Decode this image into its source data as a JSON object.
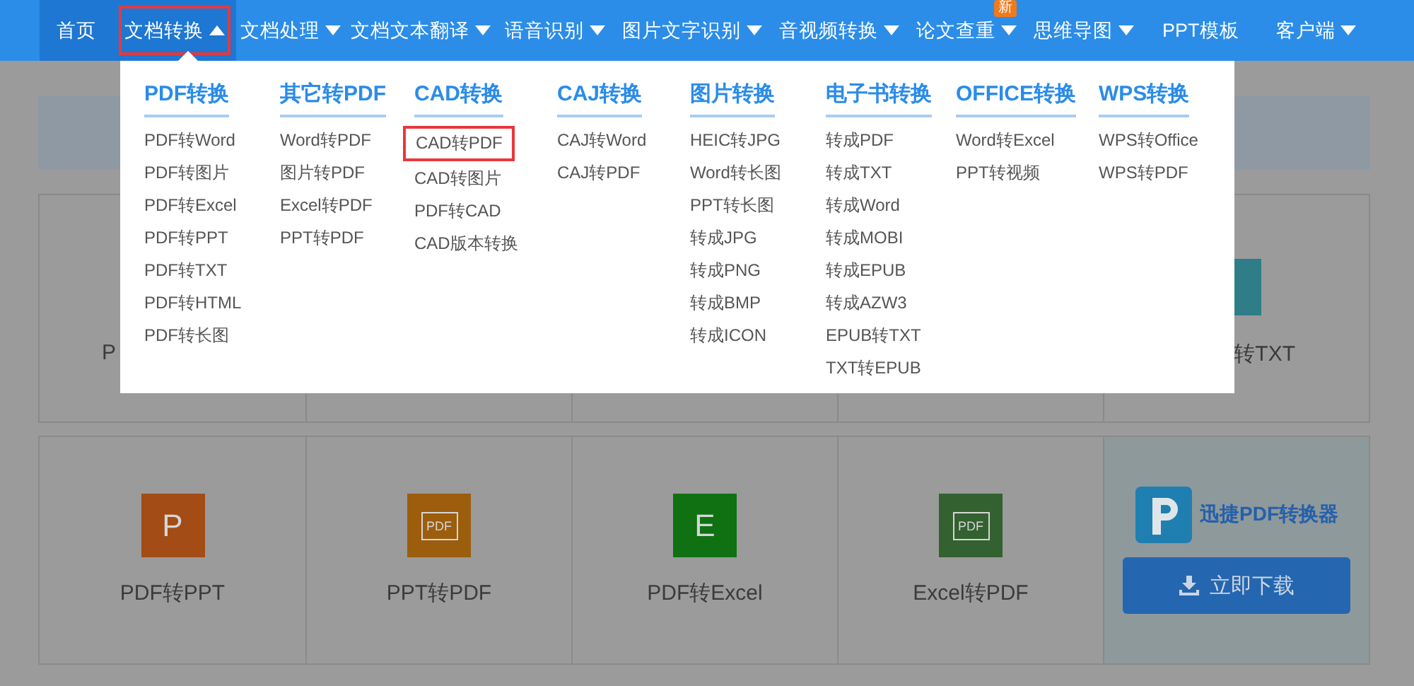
{
  "nav": [
    {
      "label": "首页",
      "kind": "link",
      "current": true
    },
    {
      "label": "文档转换",
      "kind": "menu",
      "expanded": true,
      "highlighted": true
    },
    {
      "label": "文档处理",
      "kind": "menu",
      "expanded": false
    },
    {
      "label": "文档文本翻译",
      "kind": "menu",
      "expanded": false
    },
    {
      "label": "语音识别",
      "kind": "menu",
      "expanded": false
    },
    {
      "label": "图片文字识别",
      "kind": "menu",
      "expanded": false
    },
    {
      "label": "音视频转换",
      "kind": "menu",
      "expanded": false
    },
    {
      "label": "论文查重",
      "kind": "menu",
      "expanded": false,
      "badge": "新"
    },
    {
      "label": "思维导图",
      "kind": "menu",
      "expanded": false
    },
    {
      "label": "PPT模板",
      "kind": "link",
      "current": false
    },
    {
      "label": "客户端",
      "kind": "menu",
      "expanded": false
    }
  ],
  "dropdown": {
    "columns": [
      {
        "heading": "PDF转换",
        "items": [
          {
            "label": "PDF转Word"
          },
          {
            "label": "PDF转图片"
          },
          {
            "label": "PDF转Excel"
          },
          {
            "label": "PDF转PPT"
          },
          {
            "label": "PDF转TXT"
          },
          {
            "label": "PDF转HTML"
          },
          {
            "label": "PDF转长图"
          }
        ]
      },
      {
        "heading": "其它转PDF",
        "items": [
          {
            "label": "Word转PDF"
          },
          {
            "label": "图片转PDF"
          },
          {
            "label": "Excel转PDF"
          },
          {
            "label": "PPT转PDF"
          }
        ]
      },
      {
        "heading": "CAD转换",
        "items": [
          {
            "label": "CAD转PDF",
            "highlighted": true
          },
          {
            "label": "CAD转图片"
          },
          {
            "label": "PDF转CAD"
          },
          {
            "label": "CAD版本转换"
          }
        ]
      },
      {
        "heading": "CAJ转换",
        "items": [
          {
            "label": "CAJ转Word"
          },
          {
            "label": "CAJ转PDF"
          }
        ]
      },
      {
        "heading": "图片转换",
        "items": [
          {
            "label": "HEIC转JPG"
          },
          {
            "label": "Word转长图"
          },
          {
            "label": "PPT转长图"
          },
          {
            "label": "转成JPG"
          },
          {
            "label": "转成PNG"
          },
          {
            "label": "转成BMP"
          },
          {
            "label": "转成ICON"
          }
        ]
      },
      {
        "heading": "电子书转换",
        "items": [
          {
            "label": "转成PDF"
          },
          {
            "label": "转成TXT"
          },
          {
            "label": "转成Word"
          },
          {
            "label": "转成MOBI"
          },
          {
            "label": "转成EPUB"
          },
          {
            "label": "转成AZW3"
          },
          {
            "label": "EPUB转TXT"
          },
          {
            "label": "TXT转EPUB"
          }
        ]
      },
      {
        "heading": "OFFICE转换",
        "items": [
          {
            "label": "Word转Excel"
          },
          {
            "label": "PPT转视频"
          }
        ]
      },
      {
        "heading": "WPS转换",
        "items": [
          {
            "label": "WPS转Office"
          },
          {
            "label": "WPS转PDF"
          }
        ]
      }
    ]
  },
  "tools_row_1": [
    {
      "label": "P"
    },
    {
      "label": "转TXT"
    }
  ],
  "tools_row_2": [
    {
      "label": "PDF转PPT",
      "color": "#a34c15",
      "glyph": "P"
    },
    {
      "label": "PPT转PDF",
      "color": "#9c5d0c",
      "glyph": "PDF"
    },
    {
      "label": "PDF转Excel",
      "color": "#0f7112",
      "glyph": "E"
    },
    {
      "label": "Excel转PDF",
      "color": "#33612f",
      "glyph": "PDF"
    }
  ],
  "promo": {
    "title": "迅捷PDF转换器",
    "button": "立即下载"
  }
}
